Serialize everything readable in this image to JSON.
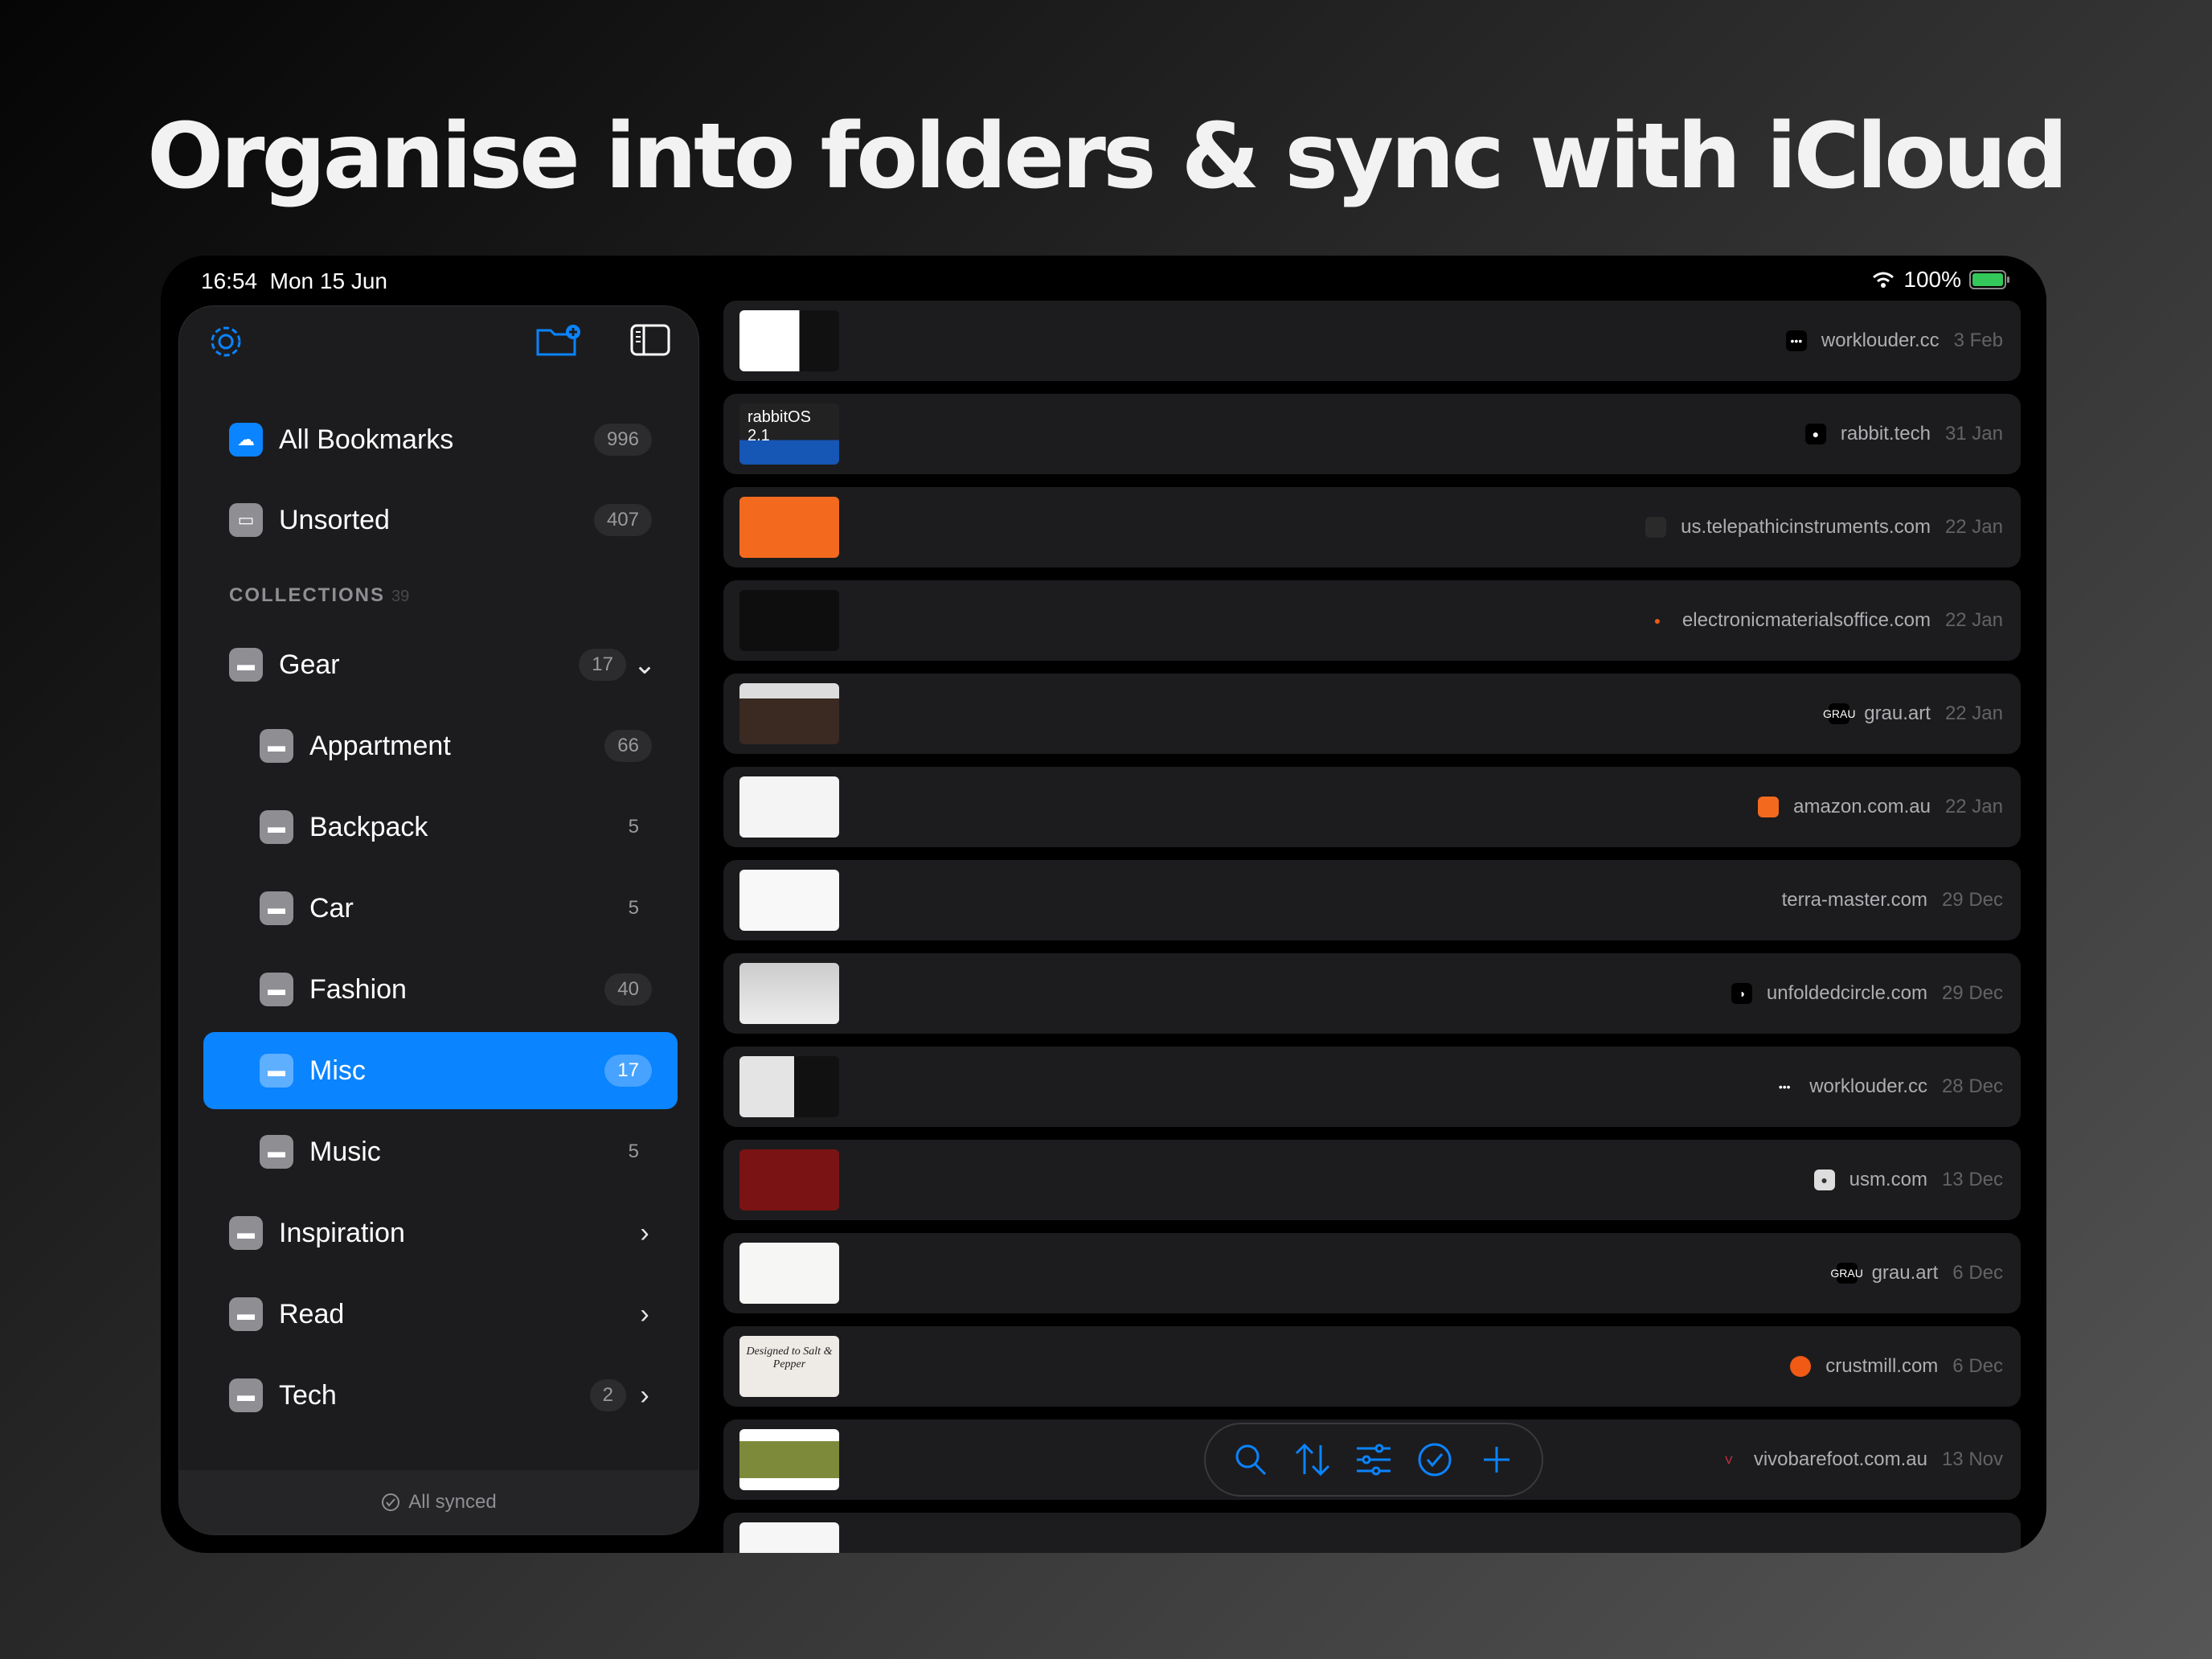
{
  "headline": "Organise into folders & sync with iCloud",
  "status": {
    "time": "16:54",
    "date": "Mon 15 Jun",
    "battery": "100%"
  },
  "sidebar": {
    "top_items": [
      {
        "label": "All Bookmarks",
        "count": "996",
        "icon": "cloud-icon"
      },
      {
        "label": "Unsorted",
        "count": "407",
        "icon": "tray-icon"
      }
    ],
    "collections_title": "COLLECTIONS",
    "collections_count": "39",
    "collections": [
      {
        "label": "Gear",
        "count": "17",
        "expanded": true
      },
      {
        "label": "Appartment",
        "count": "66",
        "sub": true
      },
      {
        "label": "Backpack",
        "count": "5",
        "sub": true
      },
      {
        "label": "Car",
        "count": "5",
        "sub": true
      },
      {
        "label": "Fashion",
        "count": "40",
        "sub": true
      },
      {
        "label": "Misc",
        "count": "17",
        "sub": true,
        "selected": true
      },
      {
        "label": "Music",
        "count": "5",
        "sub": true
      },
      {
        "label": "Inspiration",
        "count": ""
      },
      {
        "label": "Read",
        "count": ""
      },
      {
        "label": "Tech",
        "count": "2"
      }
    ],
    "footer": "All synced"
  },
  "bookmarks": [
    {
      "domain": "worklouder.cc",
      "date": "3 Feb",
      "fav": "•••"
    },
    {
      "domain": "rabbit.tech",
      "date": "31 Jan",
      "fav": "●"
    },
    {
      "domain": "us.telepathicinstruments.com",
      "date": "22 Jan",
      "fav": ""
    },
    {
      "domain": "electronicmaterialsoffice.com",
      "date": "22 Jan",
      "fav": "●"
    },
    {
      "domain": "grau.art",
      "date": "22 Jan",
      "fav": "GRAU"
    },
    {
      "domain": "amazon.com.au",
      "date": "22 Jan",
      "fav": ""
    },
    {
      "domain": "terra-master.com",
      "date": "29 Dec",
      "fav": ""
    },
    {
      "domain": "unfoldedcircle.com",
      "date": "29 Dec",
      "fav": "◑"
    },
    {
      "domain": "worklouder.cc",
      "date": "28 Dec",
      "fav": "•••"
    },
    {
      "domain": "usm.com",
      "date": "13 Dec",
      "fav": "●"
    },
    {
      "domain": "grau.art",
      "date": "6 Dec",
      "fav": "GRAU"
    },
    {
      "domain": "crustmill.com",
      "date": "6 Dec",
      "fav": ""
    },
    {
      "domain": "vivobarefoot.com.au",
      "date": "13 Nov",
      "fav": "V"
    }
  ],
  "thumb_texts": {
    "rabbit": "rabbitOS 2.1",
    "crustmill": "Designed to Salt & Pepper"
  },
  "colors": {
    "accent": "#0a84ff",
    "sidebar": "#1c1c1e",
    "row": "#1c1c1e"
  }
}
